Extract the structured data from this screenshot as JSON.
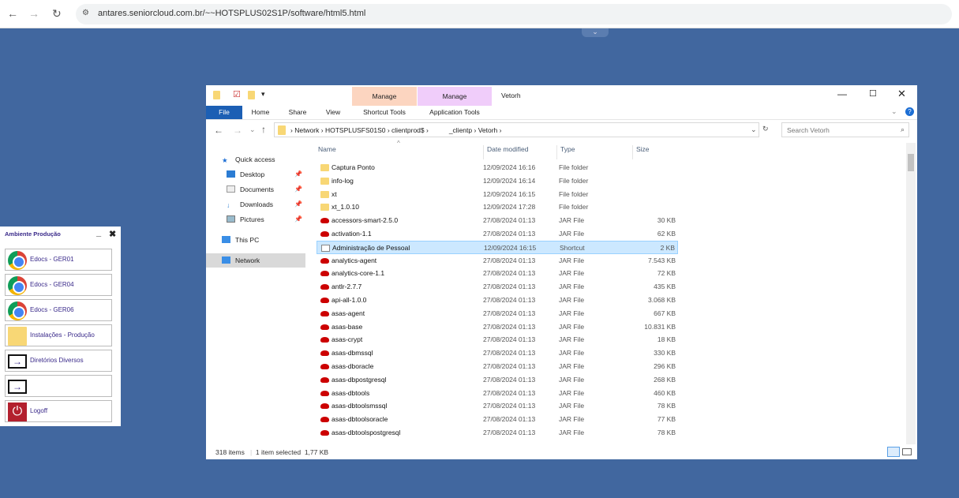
{
  "browser": {
    "url": "antares.seniorcloud.com.br/~~HOTSPLUS02S1P/software/html5.html"
  },
  "explorer": {
    "title": "Vetorh",
    "ribbon_tabs": [
      "File",
      "Home",
      "Share",
      "View"
    ],
    "context_tabs": [
      {
        "group": "Manage",
        "tab": "Shortcut Tools",
        "color": "#fcd5c0"
      },
      {
        "group": "Manage",
        "tab": "Application Tools",
        "color": "#f0cdfa"
      }
    ],
    "breadcrumb": [
      "Network",
      "HOTSPLUSFS01S0",
      "clientprod$",
      "_clientp",
      "Vetorh"
    ],
    "search_placeholder": "Search Vetorh",
    "nav": {
      "quick_access": "Quick access",
      "items": [
        "Desktop",
        "Documents",
        "Downloads",
        "Pictures"
      ],
      "this_pc": "This PC",
      "network": "Network"
    },
    "columns": [
      "Name",
      "Date modified",
      "Type",
      "Size"
    ],
    "files": [
      {
        "name": "Captura Ponto",
        "date": "12/09/2024 16:16",
        "type": "File folder",
        "size": "",
        "kind": "folder"
      },
      {
        "name": "info-log",
        "date": "12/09/2024 16:14",
        "type": "File folder",
        "size": "",
        "kind": "folder"
      },
      {
        "name": "xt",
        "date": "12/09/2024 16:15",
        "type": "File folder",
        "size": "",
        "kind": "folder"
      },
      {
        "name": "xt_1.0.10",
        "date": "12/09/2024 17:28",
        "type": "File folder",
        "size": "",
        "kind": "folder"
      },
      {
        "name": "accessors-smart-2.5.0",
        "date": "27/08/2024 01:13",
        "type": "JAR File",
        "size": "30 KB",
        "kind": "jar"
      },
      {
        "name": "activation-1.1",
        "date": "27/08/2024 01:13",
        "type": "JAR File",
        "size": "62 KB",
        "kind": "jar"
      },
      {
        "name": "Administração de Pessoal",
        "date": "12/09/2024 16:15",
        "type": "Shortcut",
        "size": "2 KB",
        "kind": "lnk",
        "selected": true
      },
      {
        "name": "analytics-agent",
        "date": "27/08/2024 01:13",
        "type": "JAR File",
        "size": "7.543 KB",
        "kind": "jar"
      },
      {
        "name": "analytics-core-1.1",
        "date": "27/08/2024 01:13",
        "type": "JAR File",
        "size": "72 KB",
        "kind": "jar"
      },
      {
        "name": "antlr-2.7.7",
        "date": "27/08/2024 01:13",
        "type": "JAR File",
        "size": "435 KB",
        "kind": "jar"
      },
      {
        "name": "api-all-1.0.0",
        "date": "27/08/2024 01:13",
        "type": "JAR File",
        "size": "3.068 KB",
        "kind": "jar"
      },
      {
        "name": "asas-agent",
        "date": "27/08/2024 01:13",
        "type": "JAR File",
        "size": "667 KB",
        "kind": "jar"
      },
      {
        "name": "asas-base",
        "date": "27/08/2024 01:13",
        "type": "JAR File",
        "size": "10.831 KB",
        "kind": "jar"
      },
      {
        "name": "asas-crypt",
        "date": "27/08/2024 01:13",
        "type": "JAR File",
        "size": "18 KB",
        "kind": "jar"
      },
      {
        "name": "asas-dbmssql",
        "date": "27/08/2024 01:13",
        "type": "JAR File",
        "size": "330 KB",
        "kind": "jar"
      },
      {
        "name": "asas-dboracle",
        "date": "27/08/2024 01:13",
        "type": "JAR File",
        "size": "296 KB",
        "kind": "jar"
      },
      {
        "name": "asas-dbpostgresql",
        "date": "27/08/2024 01:13",
        "type": "JAR File",
        "size": "268 KB",
        "kind": "jar"
      },
      {
        "name": "asas-dbtools",
        "date": "27/08/2024 01:13",
        "type": "JAR File",
        "size": "460 KB",
        "kind": "jar"
      },
      {
        "name": "asas-dbtoolsmssql",
        "date": "27/08/2024 01:13",
        "type": "JAR File",
        "size": "78 KB",
        "kind": "jar"
      },
      {
        "name": "asas-dbtoolsoracle",
        "date": "27/08/2024 01:13",
        "type": "JAR File",
        "size": "77 KB",
        "kind": "jar"
      },
      {
        "name": "asas-dbtoolspostgresql",
        "date": "27/08/2024 01:13",
        "type": "JAR File",
        "size": "78 KB",
        "kind": "jar"
      }
    ],
    "status": {
      "count": "318 items",
      "selected": "1 item selected",
      "size": "1,77 KB"
    }
  },
  "panel": {
    "title": "Ambiente Produção",
    "buttons": [
      "Edocs - GER01",
      "Edocs - GER04",
      "Edocs - GER06",
      "Instalações - Produção",
      "Diretórios Diversos",
      "",
      "Logoff"
    ]
  }
}
